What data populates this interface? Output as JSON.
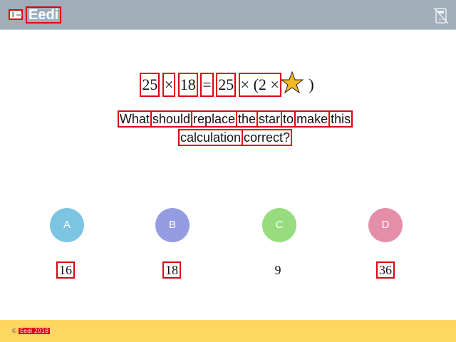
{
  "header": {
    "brand": "Eedi",
    "calculator_icon": "calculator-disabled-icon"
  },
  "question": {
    "tokens": [
      "25",
      "×",
      "18",
      "=",
      "25",
      "× (2 ×",
      ")"
    ],
    "star_icon": "star-icon",
    "star_color": "#f5b820"
  },
  "prompt": {
    "line1": [
      "What",
      "should",
      "replace",
      "the",
      "star",
      "to",
      "make",
      "this"
    ],
    "line2": [
      "calculation",
      "correct?"
    ]
  },
  "options": [
    {
      "letter": "A",
      "answer": "16",
      "color": "#7bc4e2"
    },
    {
      "letter": "B",
      "answer": "18",
      "color": "#959de2"
    },
    {
      "letter": "C",
      "answer": "9",
      "color": "#97dd80"
    },
    {
      "letter": "D",
      "answer": "36",
      "color": "#e48ea9"
    }
  ],
  "footer": {
    "copyright_symbol": "©",
    "text": "Eedi 2018"
  }
}
